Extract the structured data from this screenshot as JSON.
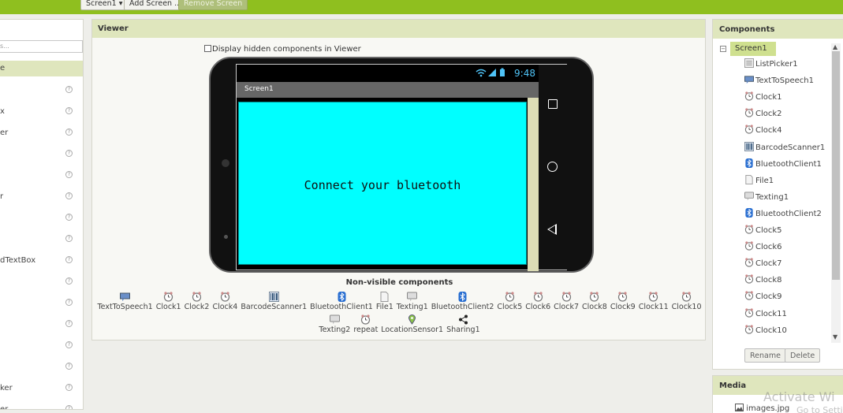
{
  "toolbar": {
    "screen_select": "Screen1 ▾",
    "add_screen": "Add Screen ...",
    "remove_screen": "Remove Screen"
  },
  "palette": {
    "search_placeholder": "s...",
    "header": "e",
    "items": [
      "",
      "x",
      "er",
      "",
      "",
      "r",
      "",
      "",
      "dTextBox",
      "",
      "",
      "",
      "",
      "",
      "ker",
      "er"
    ]
  },
  "viewer": {
    "title": "Viewer",
    "hidden_checkbox_label": "Display hidden components in Viewer",
    "phone": {
      "time": "9:48",
      "screen_title": "Screen1",
      "content_label": "Connect your bluetooth",
      "content_bg": "#00ffff"
    },
    "nonvisible_title": "Non-visible components",
    "nonvisible_row1": [
      {
        "label": "TextToSpeech1",
        "icon": "speech-icon"
      },
      {
        "label": "Clock1",
        "icon": "clock-icon"
      },
      {
        "label": "Clock2",
        "icon": "clock-icon"
      },
      {
        "label": "Clock4",
        "icon": "clock-icon"
      },
      {
        "label": "BarcodeScanner1",
        "icon": "barcode-icon"
      },
      {
        "label": "BluetoothClient1",
        "icon": "bluetooth-icon"
      },
      {
        "label": "File1",
        "icon": "file-icon"
      },
      {
        "label": "Texting1",
        "icon": "texting-icon"
      },
      {
        "label": "BluetoothClient2",
        "icon": "bluetooth-icon"
      },
      {
        "label": "Clock5",
        "icon": "clock-icon"
      },
      {
        "label": "Clock6",
        "icon": "clock-icon"
      },
      {
        "label": "Clock7",
        "icon": "clock-icon"
      },
      {
        "label": "Clock8",
        "icon": "clock-icon"
      },
      {
        "label": "Clock9",
        "icon": "clock-icon"
      },
      {
        "label": "Clock11",
        "icon": "clock-icon"
      },
      {
        "label": "Clock10",
        "icon": "clock-icon"
      }
    ],
    "nonvisible_row2": [
      {
        "label": "Texting2",
        "icon": "texting-icon"
      },
      {
        "label": "repeat",
        "icon": "clock-icon"
      },
      {
        "label": "LocationSensor1",
        "icon": "location-icon"
      },
      {
        "label": "Sharing1",
        "icon": "share-icon"
      }
    ]
  },
  "components": {
    "title": "Components",
    "root": "Screen1",
    "items": [
      {
        "label": "ListPicker1",
        "icon": "listpicker-icon"
      },
      {
        "label": "TextToSpeech1",
        "icon": "speech-icon"
      },
      {
        "label": "Clock1",
        "icon": "clock-icon"
      },
      {
        "label": "Clock2",
        "icon": "clock-icon"
      },
      {
        "label": "Clock4",
        "icon": "clock-icon"
      },
      {
        "label": "BarcodeScanner1",
        "icon": "barcode-icon"
      },
      {
        "label": "BluetoothClient1",
        "icon": "bluetooth-icon"
      },
      {
        "label": "File1",
        "icon": "file-icon"
      },
      {
        "label": "Texting1",
        "icon": "texting-icon"
      },
      {
        "label": "BluetoothClient2",
        "icon": "bluetooth-icon"
      },
      {
        "label": "Clock5",
        "icon": "clock-icon"
      },
      {
        "label": "Clock6",
        "icon": "clock-icon"
      },
      {
        "label": "Clock7",
        "icon": "clock-icon"
      },
      {
        "label": "Clock8",
        "icon": "clock-icon"
      },
      {
        "label": "Clock9",
        "icon": "clock-icon"
      },
      {
        "label": "Clock11",
        "icon": "clock-icon"
      },
      {
        "label": "Clock10",
        "icon": "clock-icon"
      }
    ],
    "rename": "Rename",
    "delete": "Delete"
  },
  "media": {
    "title": "Media",
    "file": "images.jpg"
  },
  "watermark": {
    "line1": "Activate Wi",
    "line2": "Go to Setti"
  }
}
